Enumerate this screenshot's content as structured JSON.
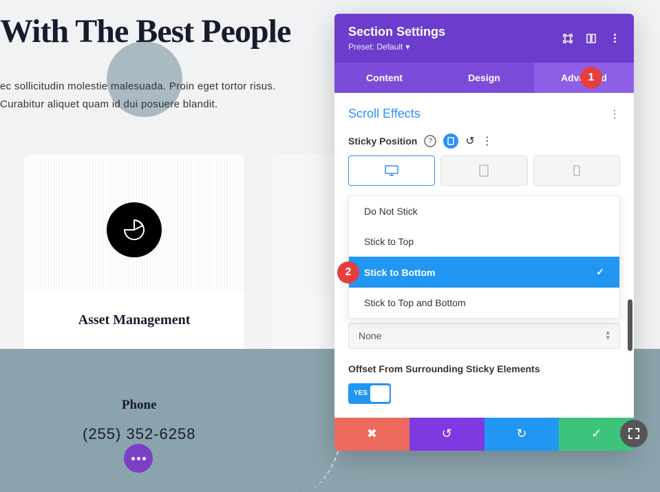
{
  "page": {
    "title": "With The Best People",
    "body_line1": "ec sollicitudin molestie malesuada. Proin eget tortor risus.",
    "body_line2": "Curabitur aliquet quam id dui posuere blandit."
  },
  "cards": [
    {
      "title": "Asset Management",
      "subtitle": "..."
    }
  ],
  "contact": {
    "label": "Phone",
    "value": "(255) 352-6258"
  },
  "modal": {
    "title": "Section Settings",
    "preset": "Preset: Default",
    "tabs": [
      "Content",
      "Design",
      "Advanced"
    ],
    "section_heading": "Scroll Effects",
    "field_label": "Sticky Position",
    "dropdown_options": [
      "Do Not Stick",
      "Stick to Top",
      "Stick to Bottom",
      "Stick to Top and Bottom"
    ],
    "select_value": "None",
    "offset_label": "Offset From Surrounding Sticky Elements",
    "toggle_label": "YES",
    "badge1": "1",
    "badge2": "2"
  }
}
